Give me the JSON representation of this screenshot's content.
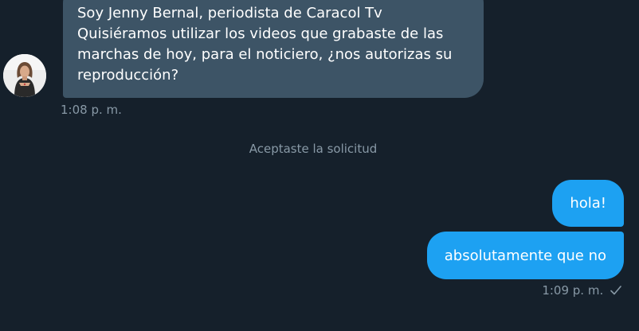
{
  "conversation": {
    "incoming": {
      "lines": [
        "Soy Jenny Bernal, periodista de Caracol Tv",
        "Quisiéramos utilizar los videos que grabaste de las",
        "marchas de hoy, para el noticiero, ¿nos autorizas su",
        "reproducción?"
      ],
      "timestamp": "1:08 p. m."
    },
    "system_message": "Aceptaste la solicitud",
    "outgoing": [
      {
        "text": "hola!"
      },
      {
        "text": "absolutamente que no"
      }
    ],
    "outgoing_timestamp": "1:09 p. m.",
    "outgoing_status_icon": "check-icon"
  },
  "colors": {
    "background": "#15202b",
    "incoming_bubble": "#3d5466",
    "outgoing_bubble": "#1da1f2",
    "meta_text": "#8899a6"
  }
}
